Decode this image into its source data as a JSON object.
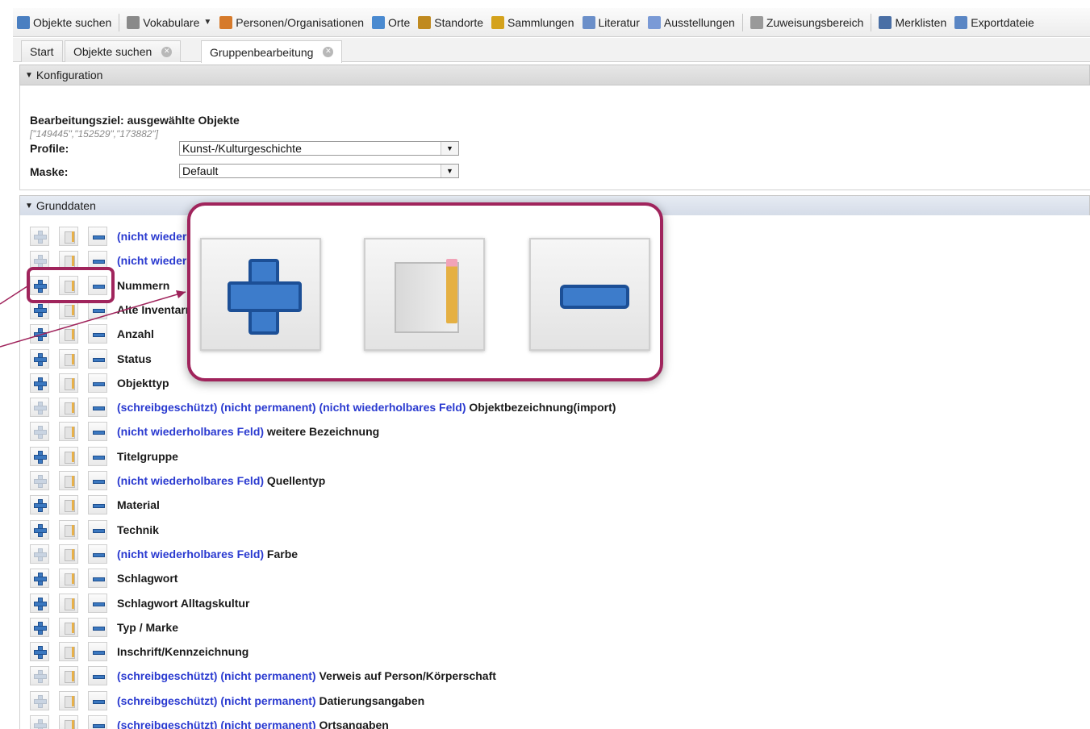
{
  "toolbar": {
    "items": [
      {
        "label": "Objekte suchen",
        "icon": "magnifier-icon",
        "color": "#4a7fc1"
      },
      {
        "label": "Vokabulare",
        "icon": "vocabulary-icon",
        "color": "#8a8a8a"
      },
      {
        "label": "Personen/Organisationen",
        "icon": "persons-icon",
        "color": "#d67a2b"
      },
      {
        "label": "Orte",
        "icon": "globe-icon",
        "color": "#4a8ad0"
      },
      {
        "label": "Standorte",
        "icon": "location-icon",
        "color": "#c08a20"
      },
      {
        "label": "Sammlungen",
        "icon": "collection-icon",
        "color": "#d4a21c"
      },
      {
        "label": "Literatur",
        "icon": "book-icon",
        "color": "#6b8fc9"
      },
      {
        "label": "Ausstellungen",
        "icon": "exhibition-icon",
        "color": "#7a9ad6"
      },
      {
        "label": "Zuweisungsbereich",
        "icon": "tools-icon",
        "color": "#9a9a9a"
      },
      {
        "label": "Merklisten",
        "icon": "bookmark-list-icon",
        "color": "#4a6fa5"
      },
      {
        "label": "Exportdateie",
        "icon": "export-icon",
        "color": "#5a86c4"
      }
    ]
  },
  "tabs": {
    "start": "Start",
    "search": "Objekte suchen",
    "group_edit": "Gruppenbearbeitung"
  },
  "konfiguration": {
    "header": "Konfiguration",
    "target": "Bearbeitungsziel: ausgewählte Objekte",
    "ids": "[\"149445\",\"152529\",\"173882\"]",
    "profile_label": "Profile:",
    "profile_value": "Kunst-/Kulturgeschichte",
    "mask_label": "Maske:",
    "mask_value": "Default"
  },
  "grunddaten": {
    "header": "Grunddaten",
    "rows": [
      {
        "qualifier": "(nicht wiederh",
        "name": "",
        "plus_enabled": false
      },
      {
        "qualifier": "(nicht wiederh",
        "name": "",
        "plus_enabled": false
      },
      {
        "qualifier": "",
        "name": "Nummern",
        "plus_enabled": true
      },
      {
        "qualifier": "",
        "name": "Alte Inventarn",
        "plus_enabled": true
      },
      {
        "qualifier": "",
        "name": "Anzahl",
        "plus_enabled": true
      },
      {
        "qualifier": "",
        "name": "Status",
        "plus_enabled": true
      },
      {
        "qualifier": "",
        "name": "Objekttyp",
        "plus_enabled": true
      },
      {
        "qualifier": "(schreibgeschützt) (nicht permanent) (nicht wiederholbares Feld)",
        "name": "Objektbezeichnung(import)",
        "plus_enabled": false
      },
      {
        "qualifier": "(nicht wiederholbares Feld)",
        "name": "weitere Bezeichnung",
        "plus_enabled": false
      },
      {
        "qualifier": "",
        "name": "Titelgruppe",
        "plus_enabled": true
      },
      {
        "qualifier": "(nicht wiederholbares Feld)",
        "name": "Quellentyp",
        "plus_enabled": false
      },
      {
        "qualifier": "",
        "name": "Material",
        "plus_enabled": true
      },
      {
        "qualifier": "",
        "name": "Technik",
        "plus_enabled": true
      },
      {
        "qualifier": "(nicht wiederholbares Feld)",
        "name": "Farbe",
        "plus_enabled": false
      },
      {
        "qualifier": "",
        "name": "Schlagwort",
        "plus_enabled": true
      },
      {
        "qualifier": "",
        "name": "Schlagwort Alltagskultur",
        "plus_enabled": true
      },
      {
        "qualifier": "",
        "name": "Typ / Marke",
        "plus_enabled": true
      },
      {
        "qualifier": "",
        "name": "Inschrift/Kennzeichnung",
        "plus_enabled": true
      },
      {
        "qualifier": "(schreibgeschützt) (nicht permanent)",
        "name": "Verweis auf Person/Körperschaft",
        "plus_enabled": false
      },
      {
        "qualifier": "(schreibgeschützt) (nicht permanent)",
        "name": "Datierungsangaben",
        "plus_enabled": false
      },
      {
        "qualifier": "(schreibgeschützt) (nicht permanent)",
        "name": "Ortsangaben",
        "plus_enabled": false
      }
    ]
  },
  "colors": {
    "highlight": "#a0245c",
    "qualifier_blue": "#2a3ad0",
    "icon_blue": "#3b78c0"
  }
}
